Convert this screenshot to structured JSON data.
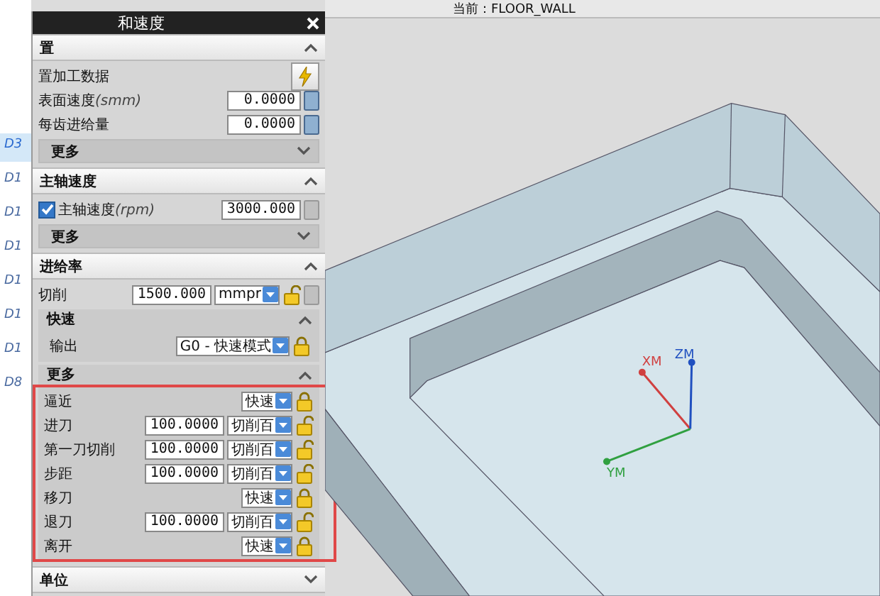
{
  "top_bar": {
    "label": "当前：FLOOR_WALL"
  },
  "left_list": [
    {
      "label": "D3",
      "selected": true
    },
    {
      "label": "D1",
      "selected": false
    },
    {
      "label": "D1",
      "selected": false
    },
    {
      "label": "D1",
      "selected": false
    },
    {
      "label": "D1",
      "selected": false
    },
    {
      "label": "D1",
      "selected": false
    },
    {
      "label": "D1",
      "selected": false
    },
    {
      "label": "D8",
      "selected": false
    }
  ],
  "dialog": {
    "title": "和速度",
    "sections": [
      {
        "title": "置",
        "expanded": true,
        "rows": [
          {
            "kind": "button",
            "label": "置加工数据"
          },
          {
            "kind": "value",
            "label": "表面速度",
            "unit": "(smm)",
            "value": "0.0000"
          },
          {
            "kind": "value",
            "label": "每齿进给量",
            "value": "0.0000"
          }
        ],
        "more": {
          "label": "更多",
          "expanded": false
        }
      },
      {
        "title": "主轴速度",
        "expanded": true,
        "rows": [
          {
            "kind": "check",
            "label": "主轴速度",
            "unit": "(rpm)",
            "checked": true,
            "value": "3000.000"
          }
        ],
        "more": {
          "label": "更多",
          "expanded": false
        }
      },
      {
        "title": "进给率",
        "expanded": true,
        "rows": [
          {
            "kind": "feed",
            "label": "切削",
            "value": "1500.000",
            "dropdown": "mmpr",
            "locked": false
          }
        ],
        "groups": [
          {
            "title": "快速",
            "expanded": true,
            "rows": [
              {
                "kind": "select",
                "label": "输出",
                "dropdown": "G0 - 快速模式",
                "locked": true
              }
            ]
          },
          {
            "title": "更多",
            "expanded": true,
            "highlighted": true,
            "rows": [
              {
                "kind": "select",
                "label": "逼近",
                "dropdown": "快速",
                "locked": true
              },
              {
                "kind": "feed",
                "label": "进刀",
                "value": "100.0000",
                "dropdown": "切削百",
                "locked": false
              },
              {
                "kind": "feed",
                "label": "第一刀切削",
                "value": "100.0000",
                "dropdown": "切削百",
                "locked": false
              },
              {
                "kind": "feed",
                "label": "步距",
                "value": "100.0000",
                "dropdown": "切削百",
                "locked": false
              },
              {
                "kind": "select",
                "label": "移刀",
                "dropdown": "快速",
                "locked": true
              },
              {
                "kind": "feed",
                "label": "退刀",
                "value": "100.0000",
                "dropdown": "切削百",
                "locked": false
              },
              {
                "kind": "select",
                "label": "离开",
                "dropdown": "快速",
                "locked": true
              }
            ]
          }
        ]
      },
      {
        "title": "单位",
        "expanded": false
      }
    ]
  },
  "axes": [
    {
      "label": "XM",
      "color": "#d04040"
    },
    {
      "label": "ZM",
      "color": "#2050c0"
    },
    {
      "label": "YM",
      "color": "#30a040"
    }
  ]
}
